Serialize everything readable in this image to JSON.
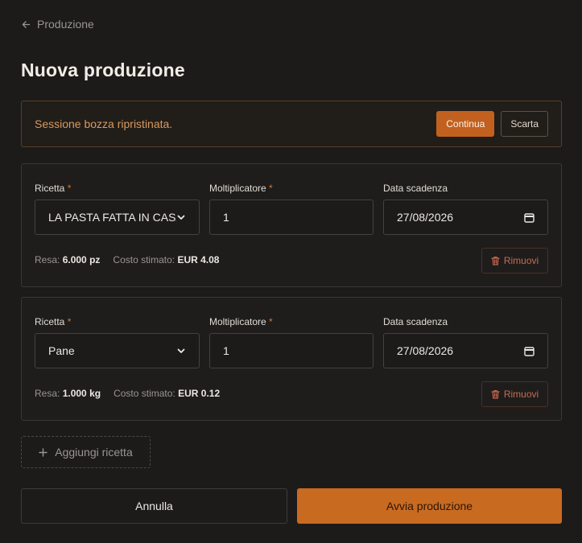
{
  "nav": {
    "back_label": "Produzione"
  },
  "page": {
    "title": "Nuova produzione"
  },
  "draft": {
    "message": "Sessione bozza ripristinata.",
    "continue_label": "Continua",
    "discard_label": "Scarta"
  },
  "labels": {
    "recipe": "Ricetta",
    "multiplier": "Moltiplicatore",
    "expiry": "Data scadenza",
    "required_mark": "*",
    "yield": "Resa:",
    "estimated_cost": "Costo stimato:",
    "remove": "Rimuovi"
  },
  "recipes": [
    {
      "recipe": "LA PASTA FATTA IN CASA",
      "multiplier": "1",
      "expiry": "27/08/2026",
      "yield": "6.000 pz",
      "cost": "EUR 4.08"
    },
    {
      "recipe": "Pane",
      "multiplier": "1",
      "expiry": "27/08/2026",
      "yield": "1.000 kg",
      "cost": "EUR 0.12"
    }
  ],
  "add_recipe_label": "Aggiungi ricetta",
  "footer": {
    "cancel_label": "Annulla",
    "start_label": "Avvia produzione"
  },
  "colors": {
    "accent": "#c96a21",
    "draft_text": "#d89a5f",
    "danger": "#c96a4f",
    "background": "#1c1b1a"
  }
}
